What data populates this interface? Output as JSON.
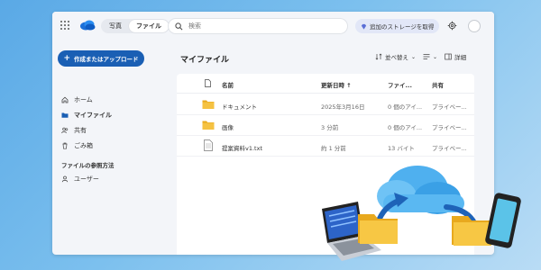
{
  "topbar": {
    "tabs": [
      {
        "label": "写真",
        "active": false
      },
      {
        "label": "ファイル",
        "active": true
      }
    ],
    "search_placeholder": "検索",
    "storage_label": "追加のストレージを取得"
  },
  "sidebar": {
    "create_label": "作成またはアップロード",
    "items": [
      {
        "label": "ホーム",
        "icon": "home-icon"
      },
      {
        "label": "マイファイル",
        "icon": "folder-icon",
        "active": true
      },
      {
        "label": "共有",
        "icon": "people-icon"
      },
      {
        "label": "ごみ箱",
        "icon": "trash-icon"
      }
    ],
    "section_title": "ファイルの参照方法",
    "section_items": [
      {
        "label": "ユーザー",
        "icon": "person-icon"
      }
    ]
  },
  "main": {
    "title": "マイファイル",
    "sort_label": "並べ替え",
    "details_label": "詳細",
    "columns": {
      "name": "名前",
      "modified": "更新日時",
      "size": "ファイ...",
      "sharing": "共有"
    },
    "rows": [
      {
        "name": "ドキュメント",
        "type": "folder",
        "modified": "2025年3月16日",
        "size": "0 個のアイ...",
        "sharing": "プライベー..."
      },
      {
        "name": "画像",
        "type": "folder",
        "modified": "3 分前",
        "size": "0 個のアイ...",
        "sharing": "プライベー..."
      },
      {
        "name": "提案資料v1.txt",
        "type": "file",
        "modified": "約 1 分前",
        "size": "13 バイト",
        "sharing": "プライベー..."
      }
    ]
  },
  "colors": {
    "accent": "#1a5fb4",
    "folder": "#f5c242",
    "background_start": "#5aa9e6",
    "background_end": "#b9dcf5"
  }
}
